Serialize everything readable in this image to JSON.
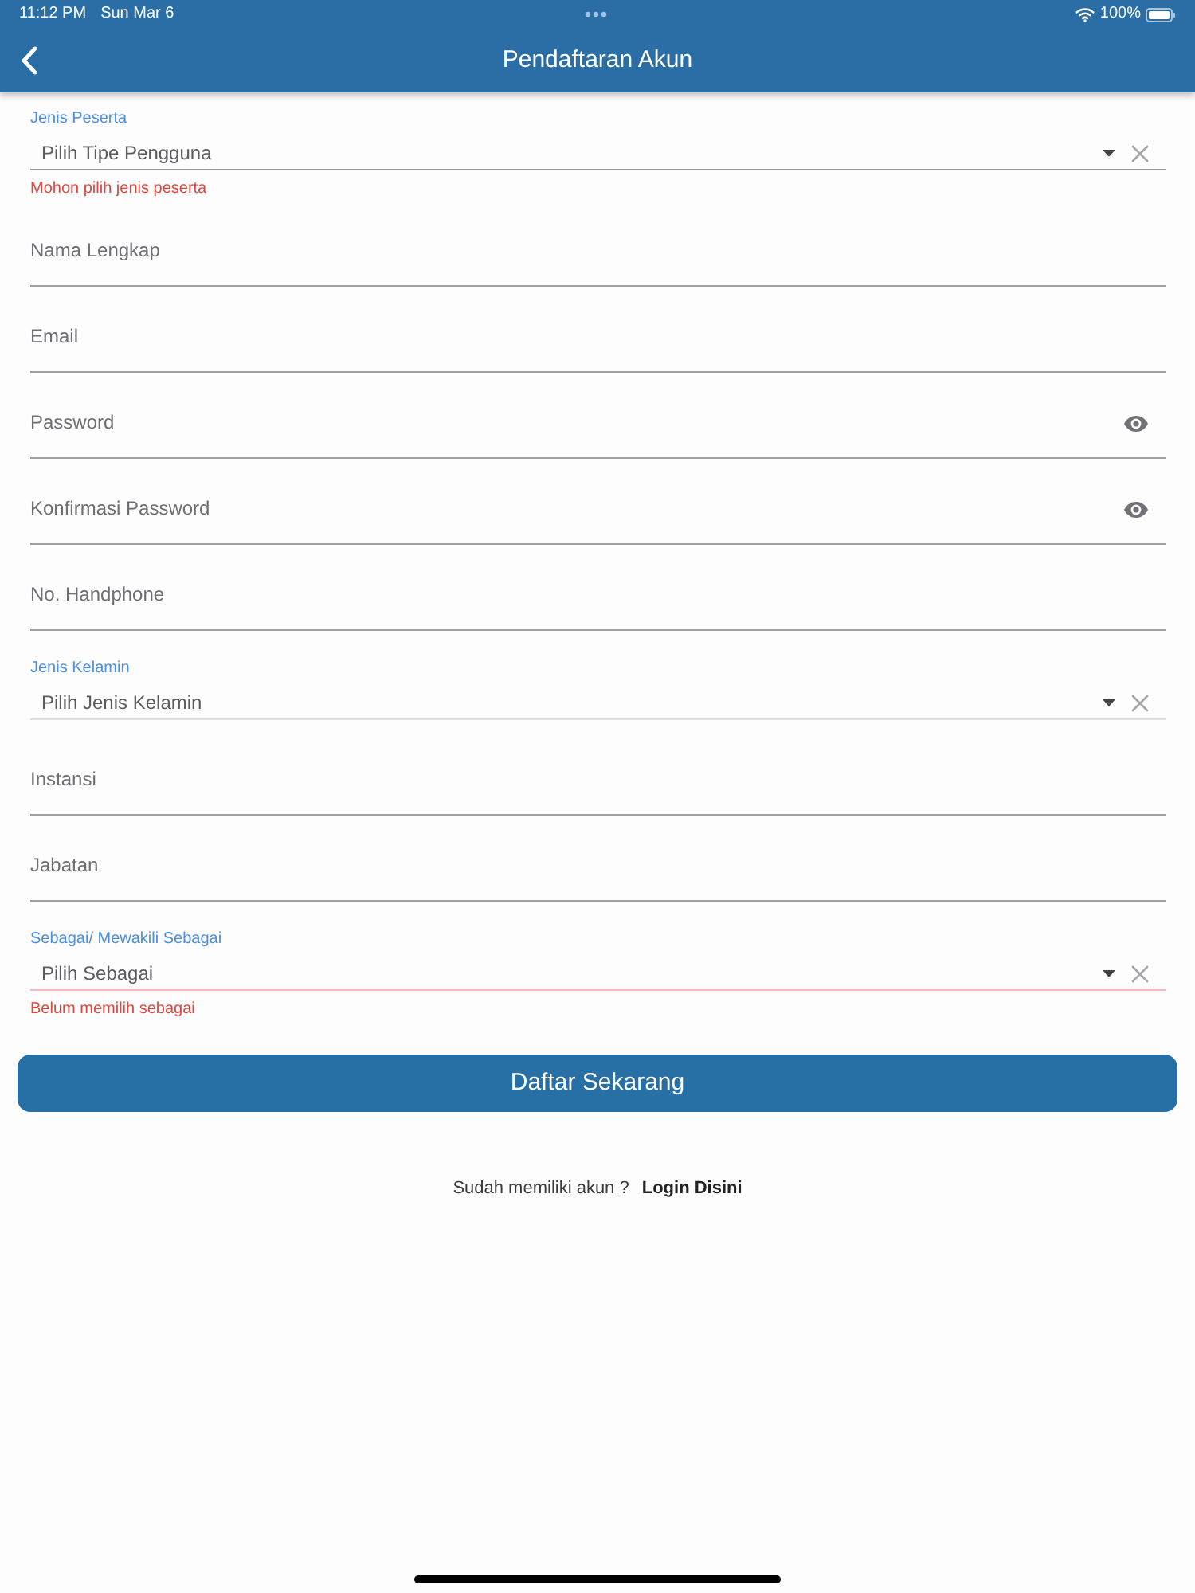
{
  "status_bar": {
    "time": "11:12 PM",
    "date": "Sun Mar 6",
    "battery": "100%"
  },
  "header": {
    "title": "Pendaftaran Akun"
  },
  "form": {
    "fields": [
      {
        "kind": "dropdown",
        "label": "Jenis Peserta",
        "placeholder": "Pilih Tipe Pengguna",
        "error": "Mohon pilih jenis peserta",
        "focused": true
      },
      {
        "kind": "text",
        "placeholder": "Nama Lengkap"
      },
      {
        "kind": "text",
        "placeholder": "Email"
      },
      {
        "kind": "password",
        "placeholder": "Password"
      },
      {
        "kind": "password",
        "placeholder": "Konfirmasi Password"
      },
      {
        "kind": "text",
        "placeholder": "No. Handphone"
      },
      {
        "kind": "dropdown",
        "label": "Jenis Kelamin",
        "placeholder": "Pilih Jenis Kelamin",
        "focused": false
      },
      {
        "kind": "text",
        "placeholder": "Instansi"
      },
      {
        "kind": "text",
        "placeholder": "Jabatan"
      },
      {
        "kind": "dropdown",
        "label": "Sebagai/ Mewakili Sebagai",
        "placeholder": "Pilih Sebagai",
        "error": "Belum memilih sebagai",
        "focused": false
      }
    ]
  },
  "submit_button": "Daftar Sekarang",
  "footer": {
    "prompt": "Sudah memiliki akun ?",
    "link": "Login Disini"
  }
}
